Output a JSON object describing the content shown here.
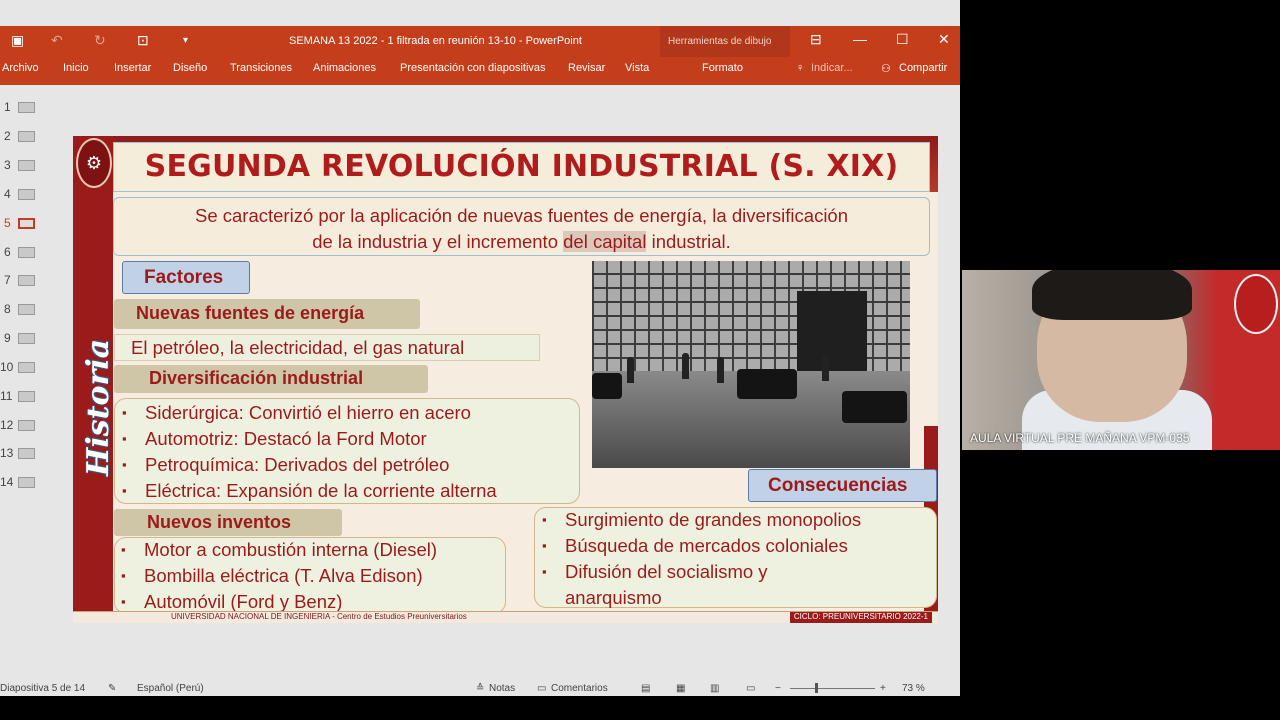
{
  "window": {
    "title": "SEMANA 13 2022 - 1 filtrada en reunión 13-10 - PowerPoint",
    "context_tool": "Herramientas de dibujo"
  },
  "ribbon": {
    "tabs": [
      "Archivo",
      "Inicio",
      "Insertar",
      "Diseño",
      "Transiciones",
      "Animaciones",
      "Presentación con diapositivas",
      "Revisar",
      "Vista",
      "Formato"
    ],
    "tell_me": "Indicar...",
    "share": "Compartir"
  },
  "thumbnails": [
    "1",
    "2",
    "3",
    "4",
    "5",
    "6",
    "7",
    "8",
    "9",
    "10",
    "11",
    "12",
    "13",
    "14"
  ],
  "active_slide": 5,
  "slide": {
    "title": "SEGUNDA REVOLUCIÓN INDUSTRIAL (S. XIX)",
    "subtitle_part1": "Se caracterizó por la aplicación de nuevas fuentes de energía, la diversificación",
    "subtitle_part2a": "de la industria y el incremento ",
    "subtitle_highlight": "del capital",
    "subtitle_part2b": " industrial.",
    "side_label": "Historia",
    "factores": "Factores",
    "nuevas_fuentes": "Nuevas fuentes de energía",
    "fuentes_line": "El petróleo, la electricidad, el gas natural",
    "diversificacion": "Diversificación industrial",
    "diversificacion_items": [
      "Siderúrgica: Convirtió el hierro en acero",
      "Automotriz: Destacó la Ford Motor",
      "Petroquímica: Derivados del petróleo",
      "Eléctrica: Expansión de la corriente alterna"
    ],
    "inventos": "Nuevos inventos",
    "inventos_items": [
      "Motor a combustión interna (Diesel)",
      "Bombilla eléctrica (T. Alva Edison)",
      "Automóvil (Ford y Benz)"
    ],
    "consecuencias": "Consecuencias",
    "consecuencias_items": [
      "Surgimiento de grandes monopolios",
      "Búsqueda de mercados coloniales",
      "Difusión del socialismo y",
      "anarquismo"
    ],
    "footer_left": "UNIVERSIDAD NACIONAL DE INGENIERIA - Centro de Estudios Preuniversitarios",
    "footer_right": "CICLO: PREUNIVERSITARIO 2022-1"
  },
  "status": {
    "slide_pos": "Diapositiva 5 de 14",
    "language": "Español (Perú)",
    "notes": "Notas",
    "comments": "Comentarios",
    "zoom": "73 %"
  },
  "video": {
    "label": "AULA VIRTUAL PRE MAÑANA VPM-035"
  },
  "colors": {
    "accent": "#c43e1c",
    "slide_red": "#9b1b1b"
  }
}
